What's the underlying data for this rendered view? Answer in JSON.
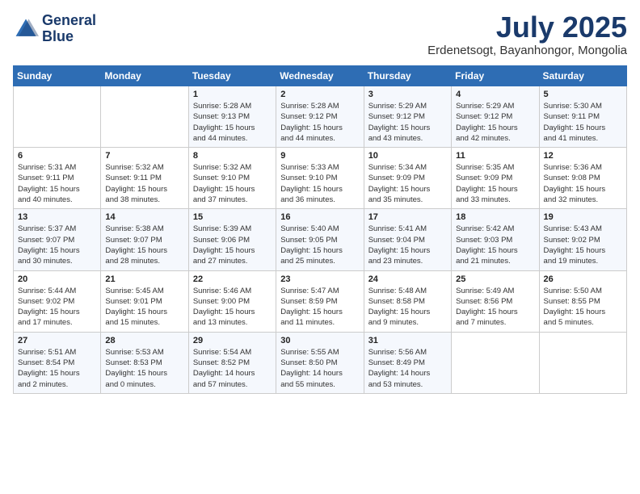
{
  "header": {
    "logo_line1": "General",
    "logo_line2": "Blue",
    "month": "July 2025",
    "location": "Erdenetsogt, Bayanhongor, Mongolia"
  },
  "weekdays": [
    "Sunday",
    "Monday",
    "Tuesday",
    "Wednesday",
    "Thursday",
    "Friday",
    "Saturday"
  ],
  "weeks": [
    [
      {
        "day": "",
        "info": ""
      },
      {
        "day": "",
        "info": ""
      },
      {
        "day": "1",
        "info": "Sunrise: 5:28 AM\nSunset: 9:13 PM\nDaylight: 15 hours\nand 44 minutes."
      },
      {
        "day": "2",
        "info": "Sunrise: 5:28 AM\nSunset: 9:12 PM\nDaylight: 15 hours\nand 44 minutes."
      },
      {
        "day": "3",
        "info": "Sunrise: 5:29 AM\nSunset: 9:12 PM\nDaylight: 15 hours\nand 43 minutes."
      },
      {
        "day": "4",
        "info": "Sunrise: 5:29 AM\nSunset: 9:12 PM\nDaylight: 15 hours\nand 42 minutes."
      },
      {
        "day": "5",
        "info": "Sunrise: 5:30 AM\nSunset: 9:11 PM\nDaylight: 15 hours\nand 41 minutes."
      }
    ],
    [
      {
        "day": "6",
        "info": "Sunrise: 5:31 AM\nSunset: 9:11 PM\nDaylight: 15 hours\nand 40 minutes."
      },
      {
        "day": "7",
        "info": "Sunrise: 5:32 AM\nSunset: 9:11 PM\nDaylight: 15 hours\nand 38 minutes."
      },
      {
        "day": "8",
        "info": "Sunrise: 5:32 AM\nSunset: 9:10 PM\nDaylight: 15 hours\nand 37 minutes."
      },
      {
        "day": "9",
        "info": "Sunrise: 5:33 AM\nSunset: 9:10 PM\nDaylight: 15 hours\nand 36 minutes."
      },
      {
        "day": "10",
        "info": "Sunrise: 5:34 AM\nSunset: 9:09 PM\nDaylight: 15 hours\nand 35 minutes."
      },
      {
        "day": "11",
        "info": "Sunrise: 5:35 AM\nSunset: 9:09 PM\nDaylight: 15 hours\nand 33 minutes."
      },
      {
        "day": "12",
        "info": "Sunrise: 5:36 AM\nSunset: 9:08 PM\nDaylight: 15 hours\nand 32 minutes."
      }
    ],
    [
      {
        "day": "13",
        "info": "Sunrise: 5:37 AM\nSunset: 9:07 PM\nDaylight: 15 hours\nand 30 minutes."
      },
      {
        "day": "14",
        "info": "Sunrise: 5:38 AM\nSunset: 9:07 PM\nDaylight: 15 hours\nand 28 minutes."
      },
      {
        "day": "15",
        "info": "Sunrise: 5:39 AM\nSunset: 9:06 PM\nDaylight: 15 hours\nand 27 minutes."
      },
      {
        "day": "16",
        "info": "Sunrise: 5:40 AM\nSunset: 9:05 PM\nDaylight: 15 hours\nand 25 minutes."
      },
      {
        "day": "17",
        "info": "Sunrise: 5:41 AM\nSunset: 9:04 PM\nDaylight: 15 hours\nand 23 minutes."
      },
      {
        "day": "18",
        "info": "Sunrise: 5:42 AM\nSunset: 9:03 PM\nDaylight: 15 hours\nand 21 minutes."
      },
      {
        "day": "19",
        "info": "Sunrise: 5:43 AM\nSunset: 9:02 PM\nDaylight: 15 hours\nand 19 minutes."
      }
    ],
    [
      {
        "day": "20",
        "info": "Sunrise: 5:44 AM\nSunset: 9:02 PM\nDaylight: 15 hours\nand 17 minutes."
      },
      {
        "day": "21",
        "info": "Sunrise: 5:45 AM\nSunset: 9:01 PM\nDaylight: 15 hours\nand 15 minutes."
      },
      {
        "day": "22",
        "info": "Sunrise: 5:46 AM\nSunset: 9:00 PM\nDaylight: 15 hours\nand 13 minutes."
      },
      {
        "day": "23",
        "info": "Sunrise: 5:47 AM\nSunset: 8:59 PM\nDaylight: 15 hours\nand 11 minutes."
      },
      {
        "day": "24",
        "info": "Sunrise: 5:48 AM\nSunset: 8:58 PM\nDaylight: 15 hours\nand 9 minutes."
      },
      {
        "day": "25",
        "info": "Sunrise: 5:49 AM\nSunset: 8:56 PM\nDaylight: 15 hours\nand 7 minutes."
      },
      {
        "day": "26",
        "info": "Sunrise: 5:50 AM\nSunset: 8:55 PM\nDaylight: 15 hours\nand 5 minutes."
      }
    ],
    [
      {
        "day": "27",
        "info": "Sunrise: 5:51 AM\nSunset: 8:54 PM\nDaylight: 15 hours\nand 2 minutes."
      },
      {
        "day": "28",
        "info": "Sunrise: 5:53 AM\nSunset: 8:53 PM\nDaylight: 15 hours\nand 0 minutes."
      },
      {
        "day": "29",
        "info": "Sunrise: 5:54 AM\nSunset: 8:52 PM\nDaylight: 14 hours\nand 57 minutes."
      },
      {
        "day": "30",
        "info": "Sunrise: 5:55 AM\nSunset: 8:50 PM\nDaylight: 14 hours\nand 55 minutes."
      },
      {
        "day": "31",
        "info": "Sunrise: 5:56 AM\nSunset: 8:49 PM\nDaylight: 14 hours\nand 53 minutes."
      },
      {
        "day": "",
        "info": ""
      },
      {
        "day": "",
        "info": ""
      }
    ]
  ]
}
